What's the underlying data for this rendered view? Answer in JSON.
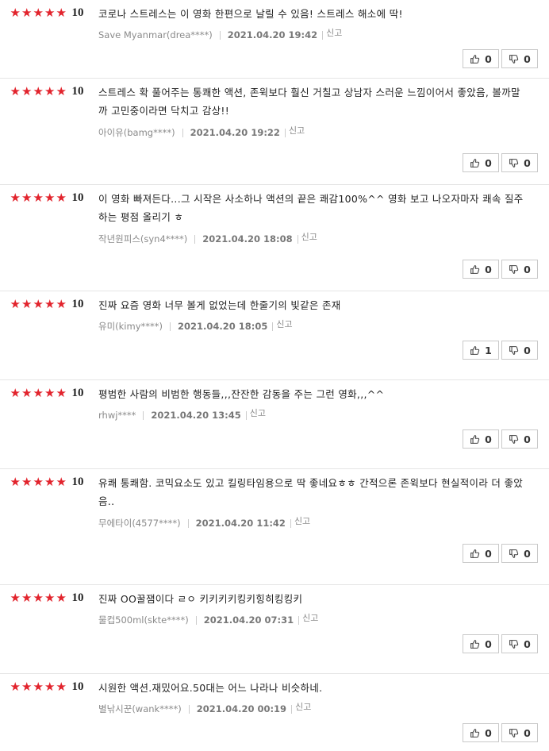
{
  "review_list": {
    "reviews": [
      {
        "score": "10",
        "text": "코로나 스트레스는 이 영화 한편으로 날릴 수 있음! 스트레스 해소에 딱!",
        "nick": "Save Myanmar(drea****)",
        "date": "2021.04.20 19:42",
        "report": "신고",
        "likes": "0",
        "dislikes": "0"
      },
      {
        "score": "10",
        "text": "스트레스 확 풀어주는 통쾌한 액션, 존윅보다 훨신 거칠고 상남자 스러운 느낌이어서 좋았음, 볼까말까 고민중이라면 닥치고 감상!!",
        "nick": "아이유(bamg****)",
        "date": "2021.04.20 19:22",
        "report": "신고",
        "likes": "0",
        "dislikes": "0"
      },
      {
        "score": "10",
        "text": "이 영화 빠져든다...그 시작은 사소하나 액션의 끝은 쾌감100%^^ 영화 보고 나오자마자 쾌속 질주하는 평점 올리기 ㅎ",
        "nick": "작년원피스(syn4****)",
        "date": "2021.04.20 18:08",
        "report": "신고",
        "likes": "0",
        "dislikes": "0"
      },
      {
        "score": "10",
        "text": "진짜 요즘 영화 너무 볼게 없었는데 한줄기의 빛같은 존재",
        "nick": "유미(kimy****)",
        "date": "2021.04.20 18:05",
        "report": "신고",
        "likes": "1",
        "dislikes": "0"
      },
      {
        "score": "10",
        "text": "평범한 사람의 비범한 행동들,,,잔잔한 감동을 주는 그런 영화,,,^^",
        "nick": "rhwj****",
        "date": "2021.04.20 13:45",
        "report": "신고",
        "likes": "0",
        "dislikes": "0"
      },
      {
        "score": "10",
        "text": "유쾌 통쾌함. 코믹요소도 있고 킬링타임용으로 딱 좋네요ㅎㅎ 간적으론 존윅보다 현실적이라 더 좋았음..",
        "nick": "무에타이(4577****)",
        "date": "2021.04.20 11:42",
        "report": "신고",
        "likes": "0",
        "dislikes": "0"
      },
      {
        "score": "10",
        "text": "진짜 OO꿀잼이다 ㄹㅇ 키키키키킹키힝히킹킹키",
        "nick": "물컵500ml(skte****)",
        "date": "2021.04.20 07:31",
        "report": "신고",
        "likes": "0",
        "dislikes": "0"
      },
      {
        "score": "10",
        "text": "시원한 액션.재밌어요.50대는 어느 나라나 비슷하네.",
        "nick": "별낚시꾼(wank****)",
        "date": "2021.04.20 00:19",
        "report": "신고",
        "likes": "0",
        "dislikes": "0"
      }
    ]
  },
  "colors": {
    "star": "#e2242d",
    "divider": "#e5e5e5"
  },
  "icons": {
    "like": "thumbs-up-icon",
    "dislike": "thumbs-down-icon",
    "star": "star-icon"
  }
}
